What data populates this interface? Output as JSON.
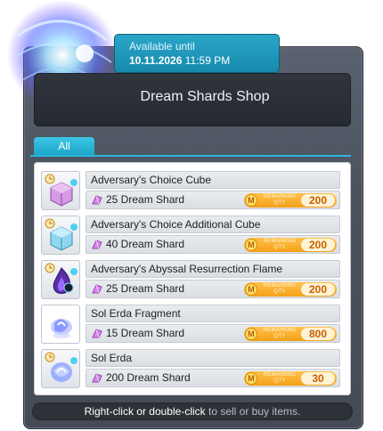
{
  "tooltip": {
    "line1": "Available until",
    "date": "10.11.2026",
    "time": "11:59 PM"
  },
  "shop": {
    "title": "Dream Shards Shop",
    "tab_all": "All"
  },
  "items": [
    {
      "name": "Adversary's Choice Cube",
      "price": "25 Dream Shard",
      "remaining_label": "REMAINING QTY",
      "qty": "200",
      "icon": "cube-icon",
      "icon_color": "#c87ad9"
    },
    {
      "name": "Adversary's Choice Additional Cube",
      "price": "40 Dream Shard",
      "remaining_label": "REMAINING QTY",
      "qty": "200",
      "icon": "additional-cube-icon",
      "icon_color": "#6fc7e8"
    },
    {
      "name": "Adversary's Abyssal Resurrection Flame",
      "price": "25 Dream Shard",
      "remaining_label": "REMAINING QTY",
      "qty": "200",
      "icon": "flame-icon",
      "icon_color": "#5a2fa8"
    },
    {
      "name": "Sol Erda Fragment",
      "price": "15 Dream Shard",
      "remaining_label": "REMAINING QTY",
      "qty": "800",
      "icon": "sol-erda-fragment-icon",
      "icon_color": "#9aa6ff"
    },
    {
      "name": "Sol Erda",
      "price": "200 Dream Shard",
      "remaining_label": "REMAINING QTY",
      "qty": "30",
      "icon": "sol-erda-icon",
      "icon_color": "#7f9cff"
    }
  ],
  "footer": {
    "action": "Right-click or double-click",
    "suffix": "to sell or buy items."
  },
  "colors": {
    "accent": "#2aa6c8",
    "quantity_pill": "#f5a019",
    "window": "#4b525e"
  }
}
